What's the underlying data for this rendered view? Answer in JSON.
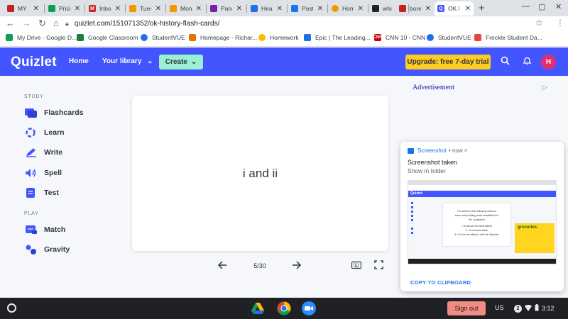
{
  "browser": {
    "tabs": [
      {
        "label": "MY",
        "fav_color": "#c5221f"
      },
      {
        "label": "Prici",
        "fav_color": "#0f9d58"
      },
      {
        "label": "Inbox",
        "fav_color": "#c5221f"
      },
      {
        "label": "Tues",
        "fav_color": "#f29900"
      },
      {
        "label": "Mon",
        "fav_color": "#f29900"
      },
      {
        "label": "Pane",
        "fav_color": "#7b1fa2"
      },
      {
        "label": "Heal",
        "fav_color": "#1a73e8"
      },
      {
        "label": "Post",
        "fav_color": "#1a73e8"
      },
      {
        "label": "Hom",
        "fav_color": "#f29900"
      },
      {
        "label": "whi",
        "fav_color": "#202124"
      },
      {
        "label": "bore",
        "fav_color": "#c5221f"
      },
      {
        "label": "OK H",
        "fav_color": "#4255ff"
      }
    ],
    "url": "quizlet.com/151071352/ok-history-flash-cards/",
    "bookmarks": [
      {
        "label": "My Drive - Google D...",
        "fav_color": "#0f9d58"
      },
      {
        "label": "Google Classroom",
        "fav_color": "#188038"
      },
      {
        "label": "StudentVUE",
        "fav_color": "#1a73e8"
      },
      {
        "label": "Homepage - Richar...",
        "fav_color": "#e37400"
      },
      {
        "label": "Homework",
        "fav_color": "#fbbc04"
      },
      {
        "label": "Epic | The Leading...",
        "fav_color": "#1a73e8"
      },
      {
        "label": "CNN 10 - CNN",
        "fav_color": "#cc0000"
      },
      {
        "label": "StudentVUE",
        "fav_color": "#1a73e8"
      },
      {
        "label": "Freckle Student Da...",
        "fav_color": "#e8453c"
      }
    ]
  },
  "quizlet": {
    "logo": "Quizlet",
    "nav": {
      "home": "Home",
      "library": "Your library",
      "create": "Create"
    },
    "upgrade": "Upgrade: free 7-day trial",
    "avatar_letter": "H",
    "sidebar": {
      "study_label": "STUDY",
      "study_modes": [
        "Flashcards",
        "Learn",
        "Write",
        "Spell",
        "Test"
      ],
      "play_label": "PLAY",
      "play_modes": [
        "Match",
        "Gravity"
      ]
    },
    "card": {
      "term": "i and ii",
      "counter": "5/30"
    },
    "ad_alt": "Advertisement"
  },
  "notification": {
    "app": "Screenshot",
    "time": "• now ˄",
    "title": "Screenshot taken",
    "subtitle": "Show in folder",
    "thumb": {
      "logo": "Quizlet",
      "lines": [
        "For which of the following reasons",
        "were early trading posts established in",
        "the Louisiana?",
        "i. To secure the land claims",
        "ii. To increase trade",
        "iii. To form an alliance with the Spanish"
      ],
      "ad_text": "groceries."
    },
    "action": "COPY TO CLIPBOARD"
  },
  "shelf": {
    "signout": "Sign out",
    "ime": "US",
    "notif_count": "2",
    "time": "3:12"
  },
  "colors": {
    "quizlet_blue": "#4255ff",
    "create_mint": "#98f1d1",
    "upgrade_yellow": "#ffcd1f",
    "avatar_pink": "#e1306c",
    "signout_red": "#f28b82"
  }
}
